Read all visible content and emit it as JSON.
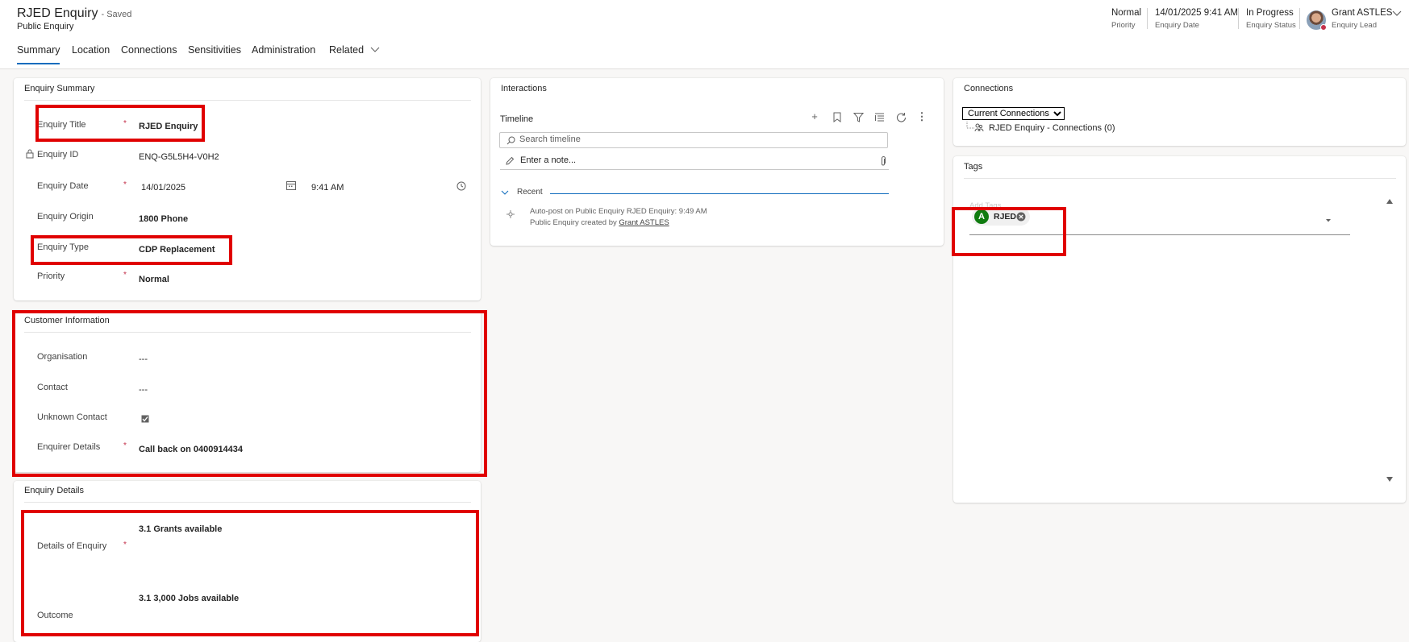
{
  "header": {
    "title": "RJED Enquiry",
    "saved_status": "- Saved",
    "entity": "Public Enquiry",
    "fields": [
      {
        "value": "Normal",
        "label": "Priority"
      },
      {
        "value": "14/01/2025 9:41 AM",
        "label": "Enquiry Date"
      },
      {
        "value": "In Progress",
        "label": "Enquiry Status"
      }
    ],
    "lead": {
      "name": "Grant ASTLES",
      "label": "Enquiry Lead"
    }
  },
  "tabs": [
    "Summary",
    "Location",
    "Connections",
    "Sensitivities",
    "Administration",
    "Related"
  ],
  "enquiry_summary": {
    "title": "Enquiry Summary",
    "enquiry_title": {
      "label": "Enquiry Title",
      "value": "RJED Enquiry"
    },
    "enquiry_id": {
      "label": "Enquiry ID",
      "value": "ENQ-G5L5H4-V0H2"
    },
    "enquiry_date": {
      "label": "Enquiry Date",
      "date": "14/01/2025",
      "time": "9:41 AM"
    },
    "enquiry_origin": {
      "label": "Enquiry Origin",
      "value": "1800 Phone"
    },
    "enquiry_type": {
      "label": "Enquiry Type",
      "value": "CDP Replacement"
    },
    "priority": {
      "label": "Priority",
      "value": "Normal"
    }
  },
  "customer_information": {
    "title": "Customer Information",
    "organisation": {
      "label": "Organisation",
      "value": "---"
    },
    "contact": {
      "label": "Contact",
      "value": "---"
    },
    "unknown_contact": {
      "label": "Unknown Contact",
      "checked": true
    },
    "enquirer_details": {
      "label": "Enquirer Details",
      "value": "Call back on 0400914434"
    }
  },
  "enquiry_details": {
    "title": "Enquiry Details",
    "details": {
      "label": "Details of Enquiry",
      "value": "3.1 Grants available"
    },
    "outcome": {
      "label": "Outcome",
      "value": "3.1 3,000 Jobs available"
    }
  },
  "interactions": {
    "title": "Interactions",
    "timeline_label": "Timeline",
    "search_placeholder": "Search timeline",
    "note_placeholder": "Enter a note...",
    "recent_label": "Recent",
    "post_line1": "Auto-post on Public Enquiry RJED Enquiry:  9:49 AM",
    "post_line2_prefix": "Public Enquiry created by ",
    "post_author": "Grant ASTLES"
  },
  "connections": {
    "title": "Connections",
    "view_selected": "Current Connections",
    "tree_item": "RJED Enquiry - Connections (0)"
  },
  "tags": {
    "title": "Tags",
    "field_label": "Add Tags",
    "tag_initial": "A",
    "tag_label": "RJED"
  }
}
